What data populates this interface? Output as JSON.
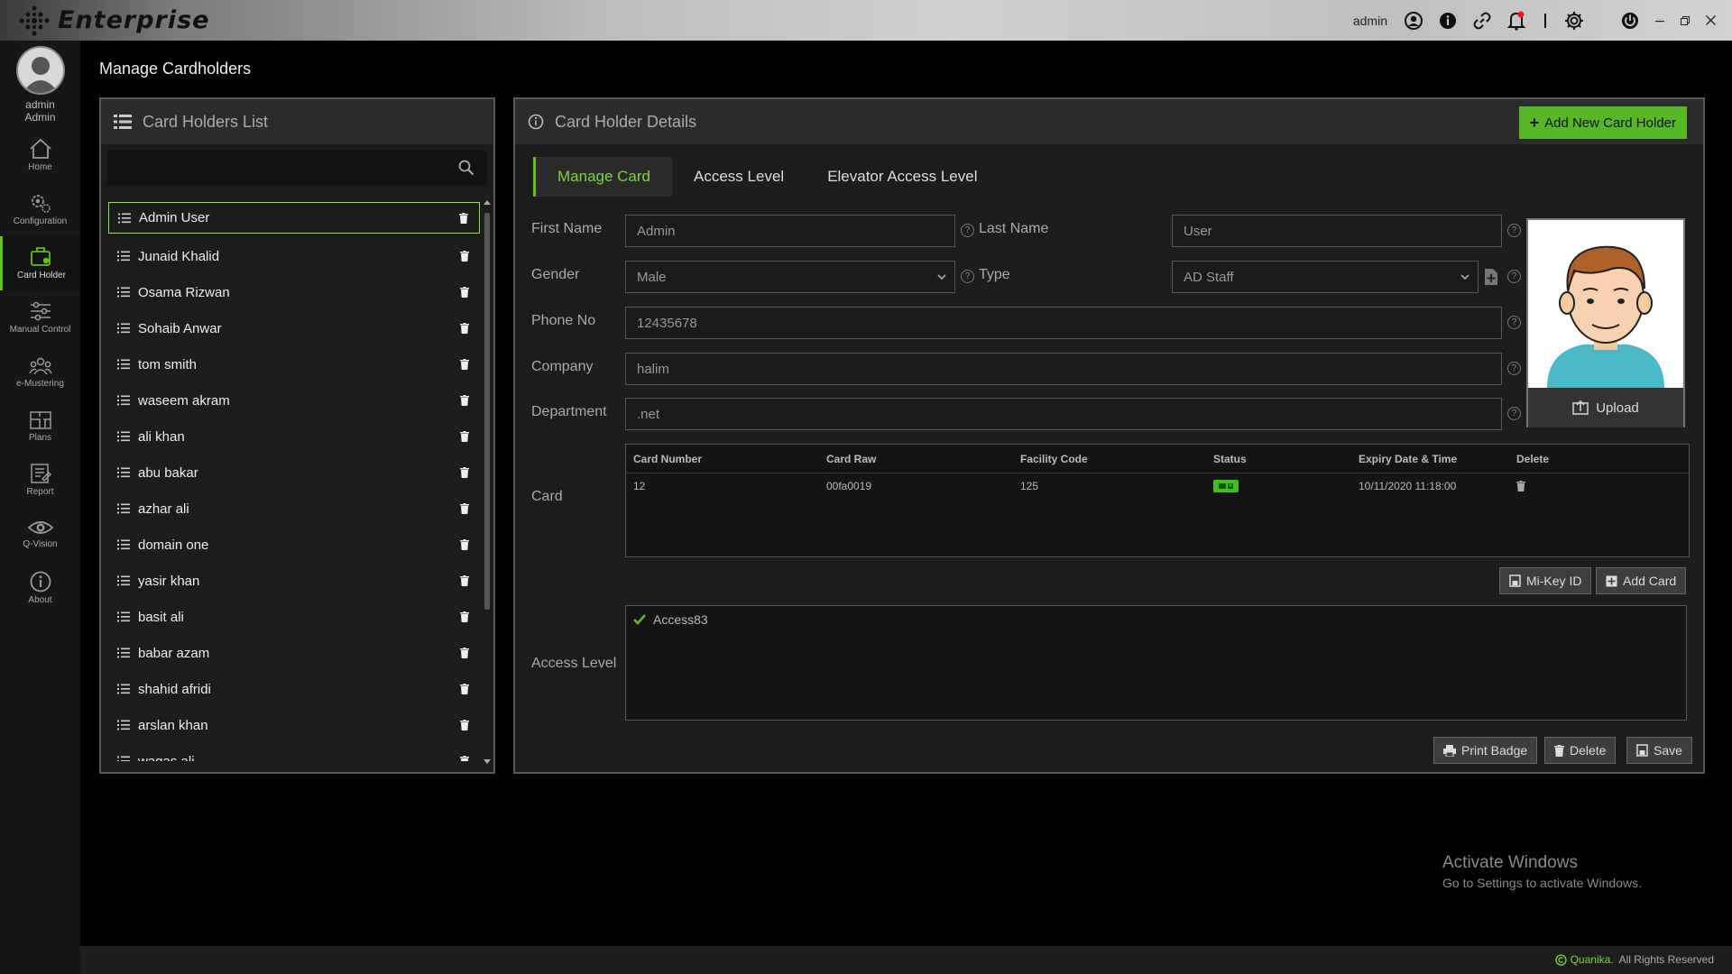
{
  "app": {
    "brand": "Enterprise"
  },
  "topbar": {
    "username": "admin"
  },
  "sidebar": {
    "user": {
      "line1": "admin",
      "line2": "Admin"
    },
    "items": [
      {
        "label": "Home",
        "icon": "home-icon"
      },
      {
        "label": "Configuration",
        "icon": "gears-icon"
      },
      {
        "label": "Card Holder",
        "icon": "card-holder-icon"
      },
      {
        "label": "Manual Control",
        "icon": "sliders-icon"
      },
      {
        "label": "e-Mustering",
        "icon": "users-icon"
      },
      {
        "label": "Plans",
        "icon": "plans-icon"
      },
      {
        "label": "Report",
        "icon": "report-icon"
      },
      {
        "label": "Q-Vision",
        "icon": "eye-icon"
      },
      {
        "label": "About",
        "icon": "info-icon"
      }
    ],
    "active_index": 2
  },
  "page": {
    "title": "Manage Cardholders"
  },
  "list_panel": {
    "title": "Card Holders List",
    "search_value": "",
    "items": [
      "Admin User",
      "Junaid Khalid",
      "Osama Rizwan",
      "Sohaib Anwar",
      "tom smith",
      "waseem akram",
      "ali khan",
      "abu bakar",
      "azhar ali",
      "domain one",
      "yasir khan",
      "basit ali",
      "babar azam",
      "shahid afridi",
      "arslan khan",
      "waqas ali"
    ],
    "selected_index": 0
  },
  "details": {
    "title": "Card Holder Details",
    "add_button": "Add New Card Holder",
    "tabs": [
      "Manage Card",
      "Access Level",
      "Elevator Access Level"
    ],
    "active_tab": 0,
    "labels": {
      "first_name": "First Name",
      "last_name": "Last Name",
      "gender": "Gender",
      "type": "Type",
      "phone": "Phone No",
      "company": "Company",
      "department": "Department",
      "card": "Card",
      "access_level": "Access Level"
    },
    "values": {
      "first_name": "Admin",
      "last_name": "User",
      "gender": "Male",
      "type": "AD Staff",
      "phone": "12435678",
      "company": "halim",
      "department": ".net"
    },
    "upload_label": "Upload",
    "card_table": {
      "headers": [
        "Card Number",
        "Card Raw",
        "Facility Code",
        "Status",
        "Expiry Date & Time",
        "Delete"
      ],
      "rows": [
        {
          "card_number": "12",
          "card_raw": "00fa0019",
          "facility_code": "125",
          "status": "active",
          "expiry": "10/11/2020 11:18:00"
        }
      ]
    },
    "card_buttons": {
      "mikey": "Mi-Key ID",
      "add_card": "Add Card"
    },
    "access_levels": [
      "Access83"
    ],
    "footer_buttons": {
      "print": "Print Badge",
      "delete": "Delete",
      "save": "Save"
    }
  },
  "watermark": {
    "line1": "Activate Windows",
    "line2": "Go to Settings to activate Windows."
  },
  "footer": {
    "brand": "Quanika.",
    "rights": "All Rights Reserved"
  },
  "colors": {
    "accent": "#62c21a",
    "add_button": "#56b728",
    "status_active": "#3ec21a"
  }
}
